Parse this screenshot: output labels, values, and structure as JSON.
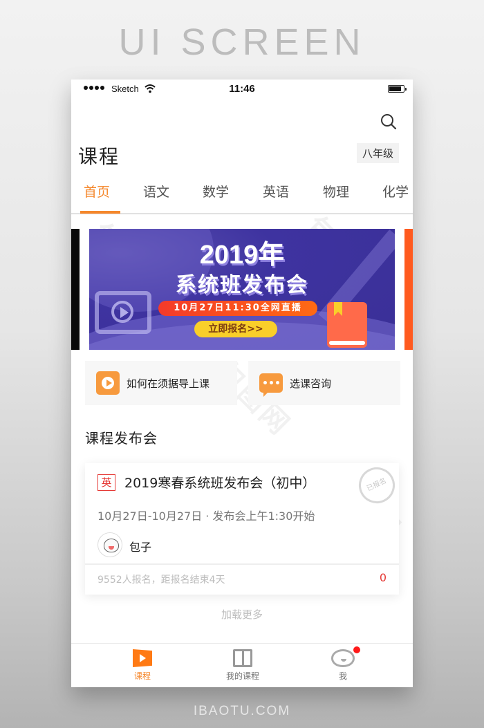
{
  "page": {
    "heading": "UI SCREEN",
    "footer_brand": "IBAOTU.COM",
    "watermark_text": "包图网"
  },
  "status_bar": {
    "carrier": "Sketch",
    "time": "11:46",
    "signal_icon": "signal-dots-icon",
    "wifi_icon": "wifi-icon",
    "battery_icon": "battery-icon"
  },
  "header": {
    "title": "课程",
    "grade_selector": "八年级",
    "search_icon": "search-icon"
  },
  "tabs": [
    {
      "label": "首页",
      "active": true
    },
    {
      "label": "语文",
      "active": false
    },
    {
      "label": "数学",
      "active": false
    },
    {
      "label": "英语",
      "active": false
    },
    {
      "label": "物理",
      "active": false
    },
    {
      "label": "化学",
      "active": false
    }
  ],
  "banner": {
    "title_line1": "2019年",
    "title_line2": "系统班发布会",
    "date_pill": "10月27日11:30全网直播",
    "cta": "立即报名>>"
  },
  "quick_links": [
    {
      "label": "如何在须据导上课",
      "icon": "play-circle-icon"
    },
    {
      "label": "选课咨询",
      "icon": "chat-bubble-icon"
    }
  ],
  "section": {
    "title": "课程发布会"
  },
  "course_card": {
    "subject_tag": "英",
    "title": "2019寒春系统班发布会（初中）",
    "stamp": "已报名",
    "date_range": "10月27日-10月27日 · 发布会上午1:30开始",
    "teacher": "包子",
    "enroll_info": "9552人报名，距报名结束4天",
    "count": "0"
  },
  "load_more": "加载更多",
  "bottom_nav": [
    {
      "label": "课程",
      "icon": "course-play-icon",
      "active": true
    },
    {
      "label": "我的课程",
      "icon": "book-icon",
      "active": false
    },
    {
      "label": "我",
      "icon": "profile-face-icon",
      "active": false,
      "has_badge": true
    }
  ],
  "colors": {
    "accent": "#f5872b",
    "quick_icon": "#f79a3e",
    "banner_bg": "#3e33a0",
    "alert_red": "#e53935",
    "badge_red": "#ff1a1a"
  }
}
